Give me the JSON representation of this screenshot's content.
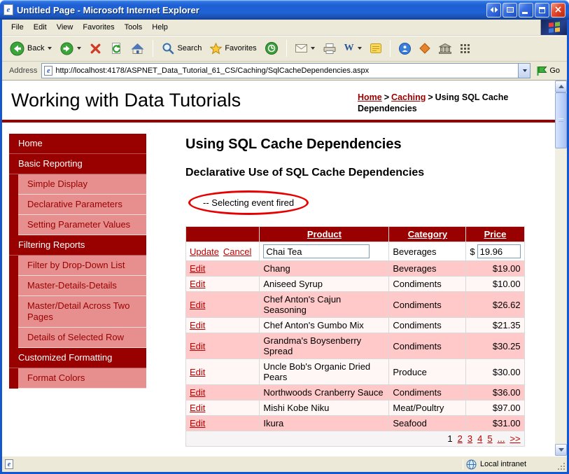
{
  "window": {
    "title": "Untitled Page - Microsoft Internet Explorer"
  },
  "menu": {
    "items": [
      "File",
      "Edit",
      "View",
      "Favorites",
      "Tools",
      "Help"
    ]
  },
  "toolbar": {
    "back": "Back",
    "search": "Search",
    "favorites": "Favorites"
  },
  "address": {
    "label": "Address",
    "url": "http://localhost:4178/ASPNET_Data_Tutorial_61_CS/Caching/SqlCacheDependencies.aspx",
    "go": "Go"
  },
  "icons": {
    "ie": "e",
    "word": "W"
  },
  "status": {
    "zone": "Local intranet"
  },
  "colors": {
    "maroon": "#990000",
    "sidebar_pink": "#E78F8F",
    "row_pink": "#FFC9C9",
    "row_light": "#FFF6F6",
    "annotation_red": "#E80000",
    "link_red": "#C00000"
  },
  "page": {
    "site_title": "Working with Data Tutorials",
    "breadcrumb": {
      "home": "Home",
      "sep": ">",
      "section": "Caching",
      "current": "Using SQL Cache Dependencies"
    },
    "heading": "Using SQL Cache Dependencies",
    "subheading": "Declarative Use of SQL Cache Dependencies",
    "event_message": "-- Selecting event fired",
    "sidebar": [
      {
        "label": "Home",
        "type": "header"
      },
      {
        "label": "Basic Reporting",
        "type": "header"
      },
      {
        "label": "Simple Display",
        "type": "sub"
      },
      {
        "label": "Declarative Parameters",
        "type": "sub"
      },
      {
        "label": "Setting Parameter Values",
        "type": "sub"
      },
      {
        "label": "Filtering Reports",
        "type": "header"
      },
      {
        "label": "Filter by Drop-Down List",
        "type": "sub"
      },
      {
        "label": "Master-Details-Details",
        "type": "sub"
      },
      {
        "label": "Master/Detail Across Two Pages",
        "type": "sub"
      },
      {
        "label": "Details of Selected Row",
        "type": "sub"
      },
      {
        "label": "Customized Formatting",
        "type": "header"
      },
      {
        "label": "Format Colors",
        "type": "sub"
      }
    ],
    "grid": {
      "headers": {
        "product": "Product",
        "category": "Category",
        "price": "Price"
      },
      "edit_row": {
        "update": "Update",
        "cancel": "Cancel",
        "product": "Chai Tea",
        "category": "Beverages",
        "currency": "$",
        "price": "19.96"
      },
      "rows": [
        {
          "action": "Edit",
          "product": "Chang",
          "category": "Beverages",
          "price": "$19.00"
        },
        {
          "action": "Edit",
          "product": "Aniseed Syrup",
          "category": "Condiments",
          "price": "$10.00"
        },
        {
          "action": "Edit",
          "product": "Chef Anton's Cajun Seasoning",
          "category": "Condiments",
          "price": "$26.62"
        },
        {
          "action": "Edit",
          "product": "Chef Anton's Gumbo Mix",
          "category": "Condiments",
          "price": "$21.35"
        },
        {
          "action": "Edit",
          "product": "Grandma's Boysenberry Spread",
          "category": "Condiments",
          "price": "$30.25"
        },
        {
          "action": "Edit",
          "product": "Uncle Bob's Organic Dried Pears",
          "category": "Produce",
          "price": "$30.00"
        },
        {
          "action": "Edit",
          "product": "Northwoods Cranberry Sauce",
          "category": "Condiments",
          "price": "$36.00"
        },
        {
          "action": "Edit",
          "product": "Mishi Kobe Niku",
          "category": "Meat/Poultry",
          "price": "$97.00"
        },
        {
          "action": "Edit",
          "product": "Ikura",
          "category": "Seafood",
          "price": "$31.00"
        }
      ],
      "pager": {
        "current": "1",
        "links": [
          "2",
          "3",
          "4",
          "5"
        ],
        "more": "...",
        "next": ">>"
      }
    }
  }
}
